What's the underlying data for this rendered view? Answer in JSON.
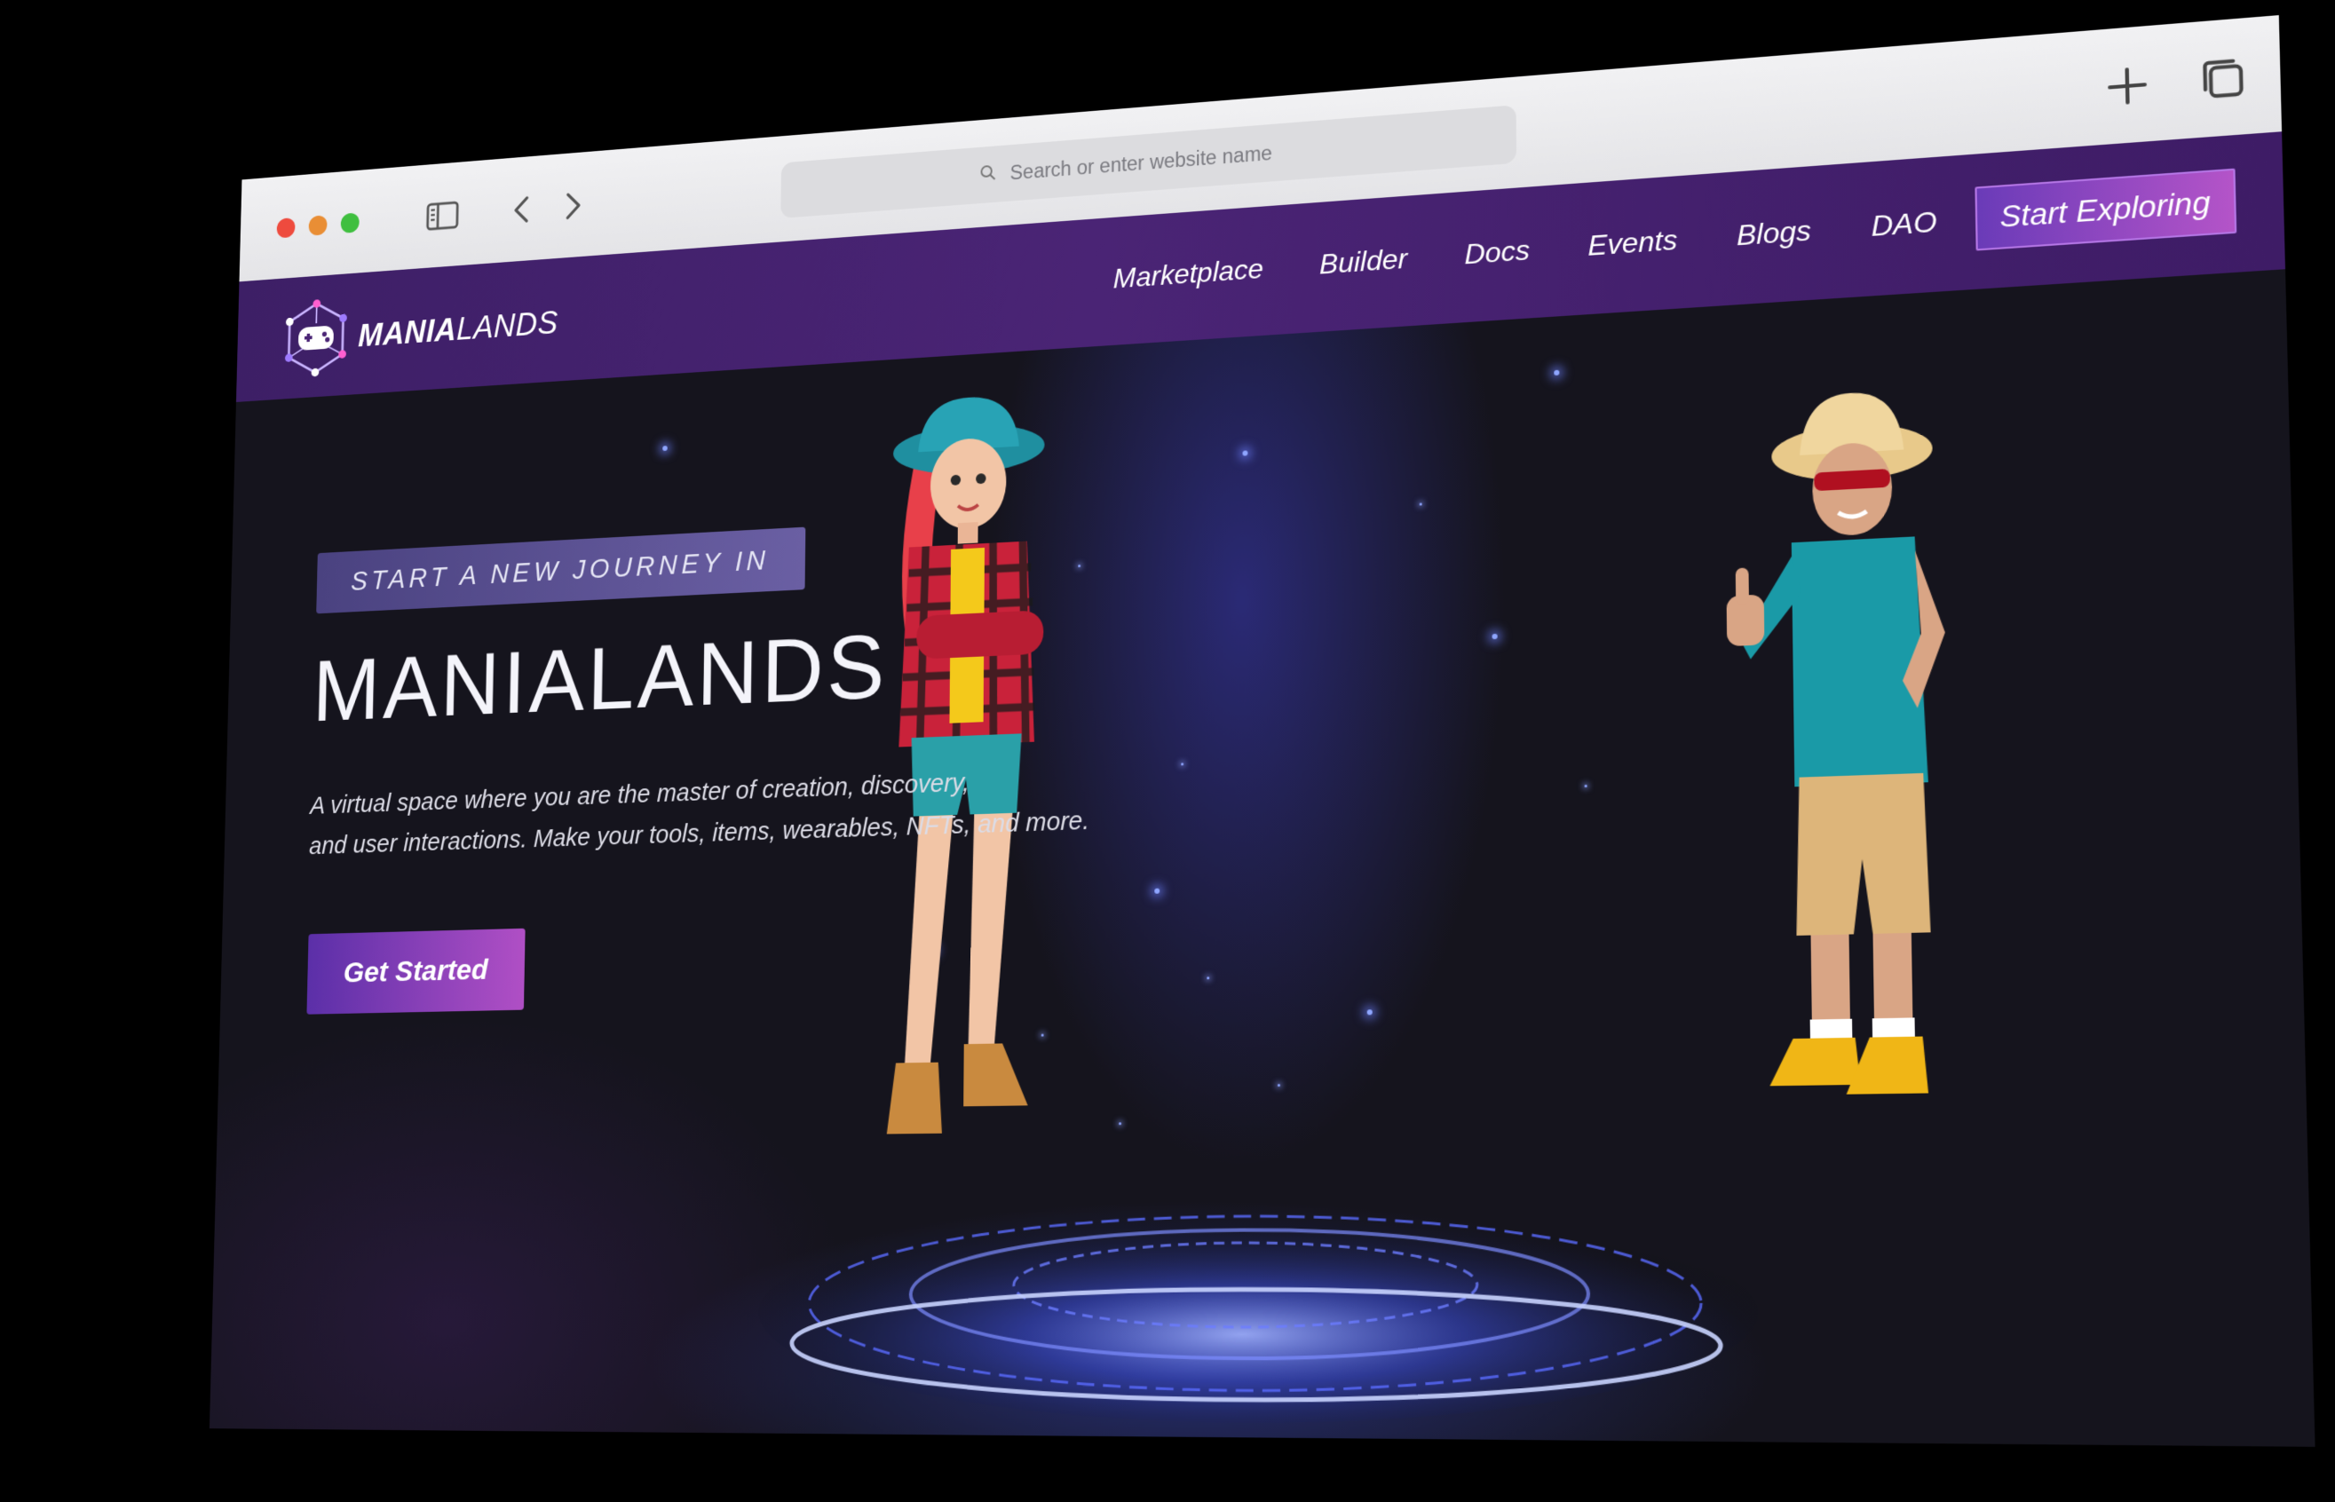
{
  "browser": {
    "url_placeholder": "Search or enter website name",
    "icons": {
      "sidebar": "sidebar-toggle-icon",
      "back": "chevron-left-icon",
      "forward": "chevron-right-icon",
      "search": "search-icon",
      "new_tab": "plus-icon",
      "tabs": "tabs-overview-icon"
    }
  },
  "site": {
    "logo": {
      "bold": "MANIA",
      "light": "LANDS"
    },
    "nav": {
      "links": [
        "Marketplace",
        "Builder",
        "Docs",
        "Events",
        "Blogs",
        "DAO"
      ],
      "cta": "Start Exploring"
    }
  },
  "hero": {
    "badge": "START A NEW JOURNEY IN",
    "headline": "MANIALANDS",
    "subtext_line1": "A virtual space where you are the master of creation, discovery,",
    "subtext_line2": "and user interactions. Make your tools, items, wearables, NFTs, and more.",
    "cta": "Get Started"
  },
  "colors": {
    "nav_bg": "#4a2475",
    "hero_bg": "#15141d",
    "accent_start": "#5b2fa8",
    "accent_end": "#b04fc5",
    "traffic_red": "#ee4b3e",
    "traffic_yellow": "#e98e35",
    "traffic_green": "#3fbf3f"
  }
}
